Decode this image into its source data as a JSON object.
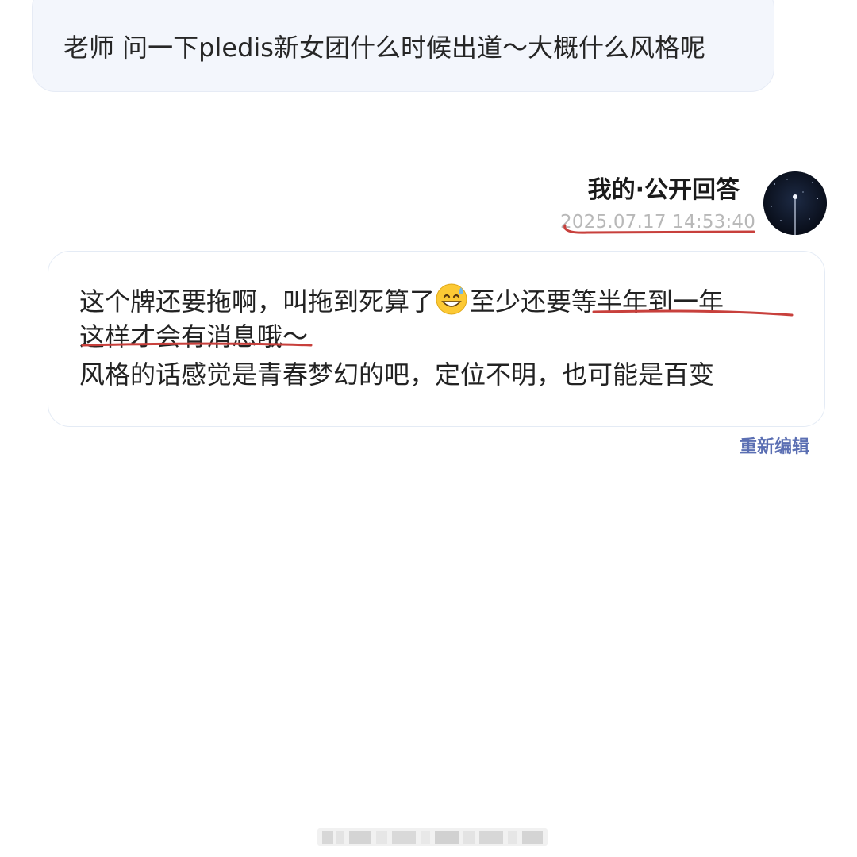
{
  "question": {
    "text": "老师 问一下pledis新女团什么时候出道～大概什么风格呢"
  },
  "answer": {
    "title": "我的·公开回答",
    "timestamp": "2025.07.17 14:53:40",
    "line1_part1": "这个牌还要拖啊，叫拖到死算了",
    "emoji": "😅",
    "line1_part2": "至少还要等半年到一年",
    "line2": "这样才会有消息哦～",
    "line3": "风格的话感觉是青春梦幻的吧，定位不明，也可能是百变",
    "edit_label": "重新编辑"
  },
  "avatar": {
    "icon": "crescent-moon-night-avatar-icon"
  },
  "markup": {
    "underline_color": "#c8403c"
  },
  "colors": {
    "question_bubble": "#f3f6fc",
    "edit_link": "#5b6fb3",
    "timestamp": "#b8b8b8"
  }
}
